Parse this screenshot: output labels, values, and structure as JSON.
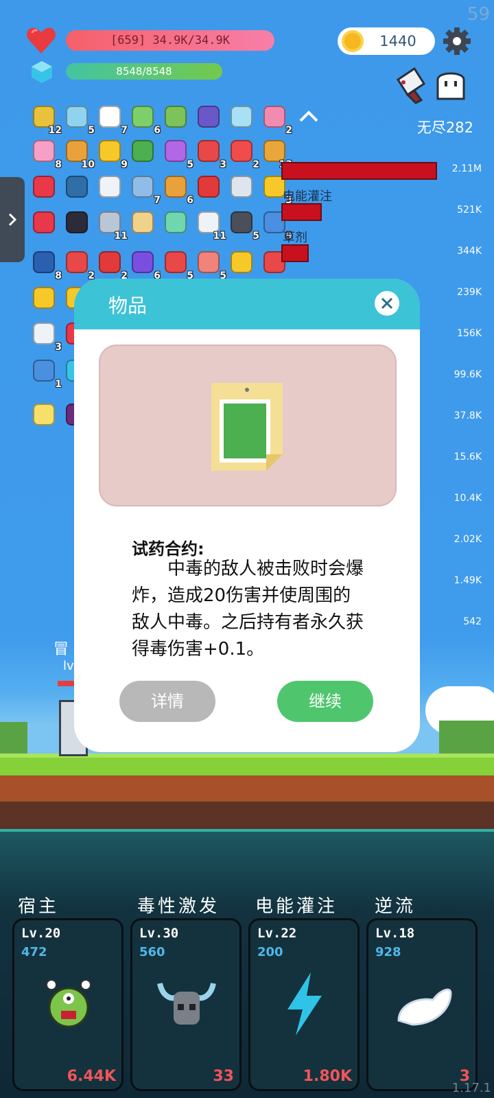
{
  "hud": {
    "fps": "59",
    "hp_text": "[659] 34.9K/34.9K",
    "mana_text": "8548/8548",
    "coins": "1440",
    "mode": "无尽282",
    "icons": {
      "hp": "heart-icon",
      "mana": "gem-icon",
      "coin": "coin-icon",
      "settings": "gear-icon"
    }
  },
  "items": [
    {
      "icon": "pineapple-icon",
      "count": "12",
      "color": "#e8c23a"
    },
    {
      "icon": "syringe-icon",
      "count": "5",
      "color": "#8fd3ef"
    },
    {
      "icon": "ghost-icon",
      "count": "7",
      "color": "#ffffff"
    },
    {
      "icon": "money-heart-icon",
      "count": "6",
      "color": "#7ecf6a"
    },
    {
      "icon": "flask-icon",
      "count": "",
      "color": "#7cc45a"
    },
    {
      "icon": "wizard-hat-icon",
      "count": "",
      "color": "#6a58c8"
    },
    {
      "icon": "potion-orb-icon",
      "count": "",
      "color": "#a8e0f5"
    },
    {
      "icon": "spray-bottle-icon",
      "count": "2",
      "color": "#f38bb0"
    },
    {
      "icon": "ice-cream-icon",
      "count": "8",
      "color": "#f6a0c8"
    },
    {
      "icon": "book-icon",
      "count": "10",
      "color": "#e9a23b"
    },
    {
      "icon": "sun-icon",
      "count": "9",
      "color": "#f7c928"
    },
    {
      "icon": "green-card-icon",
      "count": "",
      "color": "#4caf50"
    },
    {
      "icon": "crystal-ball-icon",
      "count": "5",
      "color": "#b267e6"
    },
    {
      "icon": "sock-icon",
      "count": "3",
      "color": "#e84848"
    },
    {
      "icon": "pill-icon",
      "count": "2",
      "color": "#f04c4c"
    },
    {
      "icon": "pineapple-small-icon",
      "count": "13",
      "color": "#e9a63a"
    },
    {
      "icon": "ruby-icon",
      "count": "",
      "color": "#e8384a"
    },
    {
      "icon": "speech-bubble-icon",
      "count": "",
      "color": "#2f6fa8"
    },
    {
      "icon": "cloud-icon",
      "count": "",
      "color": "#eef3f8"
    },
    {
      "icon": "shirt-icon",
      "count": "7",
      "color": "#8fbde8"
    },
    {
      "icon": "briefcase-icon",
      "count": "6",
      "color": "#e9a23b"
    },
    {
      "icon": "magnet-icon",
      "count": "",
      "color": "#e23a3a"
    },
    {
      "icon": "wind-lines-icon",
      "count": "",
      "color": "#dde6ef"
    },
    {
      "icon": "sunflower-icon",
      "count": "3",
      "color": "#f7c928"
    },
    {
      "icon": "jam-jar-icon",
      "count": "",
      "color": "#e8384a"
    },
    {
      "icon": "bat-icon",
      "count": "",
      "color": "#2b2b3a"
    },
    {
      "icon": "dagger-icon",
      "count": "11",
      "color": "#b8c6d6"
    },
    {
      "icon": "scroll-icon",
      "count": "",
      "color": "#f1d28a"
    },
    {
      "icon": "alien-icon",
      "count": "",
      "color": "#6fd6b0"
    },
    {
      "icon": "envelope-icon",
      "count": "11",
      "color": "#eef3f8"
    },
    {
      "icon": "skull-book-icon",
      "count": "5",
      "color": "#4a4f5a"
    },
    {
      "icon": "star-card-icon",
      "count": "9",
      "color": "#4a8fe0"
    },
    {
      "icon": "target-icon",
      "count": "8",
      "color": "#2b5fb0"
    },
    {
      "icon": "thermometer-icon",
      "count": "2",
      "color": "#e84848"
    },
    {
      "icon": "apple-icon",
      "count": "2",
      "color": "#e23a3a"
    },
    {
      "icon": "star-box-icon",
      "count": "6",
      "color": "#7a4fe0"
    },
    {
      "icon": "mushroom-icon",
      "count": "5",
      "color": "#e84848"
    },
    {
      "icon": "steak-icon",
      "count": "5",
      "color": "#f0837a"
    },
    {
      "icon": "ring-icon",
      "count": "",
      "color": "#f7c928"
    },
    {
      "icon": "percent-card-icon",
      "count": "",
      "color": "#e84848"
    },
    {
      "icon": "magic-wand-icon",
      "count": "",
      "color": "#f7c928"
    },
    {
      "icon": "coin-partial-icon",
      "count": "",
      "color": "#f7c928"
    },
    {
      "icon": "dice-icon",
      "count": "3",
      "color": "#eef3f8"
    },
    {
      "icon": "heart-partial-icon",
      "count": "",
      "color": "#e8384a"
    },
    {
      "icon": "shield-icon",
      "count": "1",
      "color": "#4a8fe0"
    },
    {
      "icon": "hexagon-icon",
      "count": "",
      "color": "#38c4e8"
    },
    {
      "icon": "bulb-tile-icon",
      "count": "",
      "color": "#f7e06a"
    },
    {
      "icon": "dark-tile-icon",
      "count": "",
      "color": "#6a2b7a"
    }
  ],
  "damage": {
    "bars": [
      {
        "label": "",
        "fill": 0.98
      },
      {
        "label": "电能灌注",
        "fill": 0.24
      },
      {
        "label": "草剂",
        "fill": 0.16
      },
      {
        "label": "",
        "fill": 0
      }
    ],
    "scale": [
      "2.11M",
      "521K",
      "344K",
      "239K",
      "156K",
      "99.6K",
      "37.8K",
      "15.6K",
      "10.4K",
      "2.02K",
      "1.49K",
      "542"
    ]
  },
  "hero": {
    "label": "冒",
    "level": "lv"
  },
  "modal": {
    "title": "物品",
    "item_name": "试药合约:",
    "description": "　　中毒的敌人被击败时会爆炸，造成20伤害并使周围的敌人中毒。之后持有者永久获得毒伤害+0.1。",
    "detail_button": "详情",
    "continue_button": "继续",
    "icon": "contract-icon"
  },
  "skills": [
    {
      "name": "宿主",
      "level": "Lv.20",
      "number": "472",
      "value": "6.44K",
      "icon": "virus-monster-icon"
    },
    {
      "name": "毒性激发",
      "level": "Lv.30",
      "number": "560",
      "value": "33",
      "icon": "viking-skull-icon"
    },
    {
      "name": "电能灌注",
      "level": "Lv.22",
      "number": "200",
      "value": "1.80K",
      "icon": "lightning-icon"
    },
    {
      "name": "逆流",
      "level": "Lv.18",
      "number": "928",
      "value": "3",
      "icon": "wing-icon"
    }
  ],
  "version": "1.17.1"
}
